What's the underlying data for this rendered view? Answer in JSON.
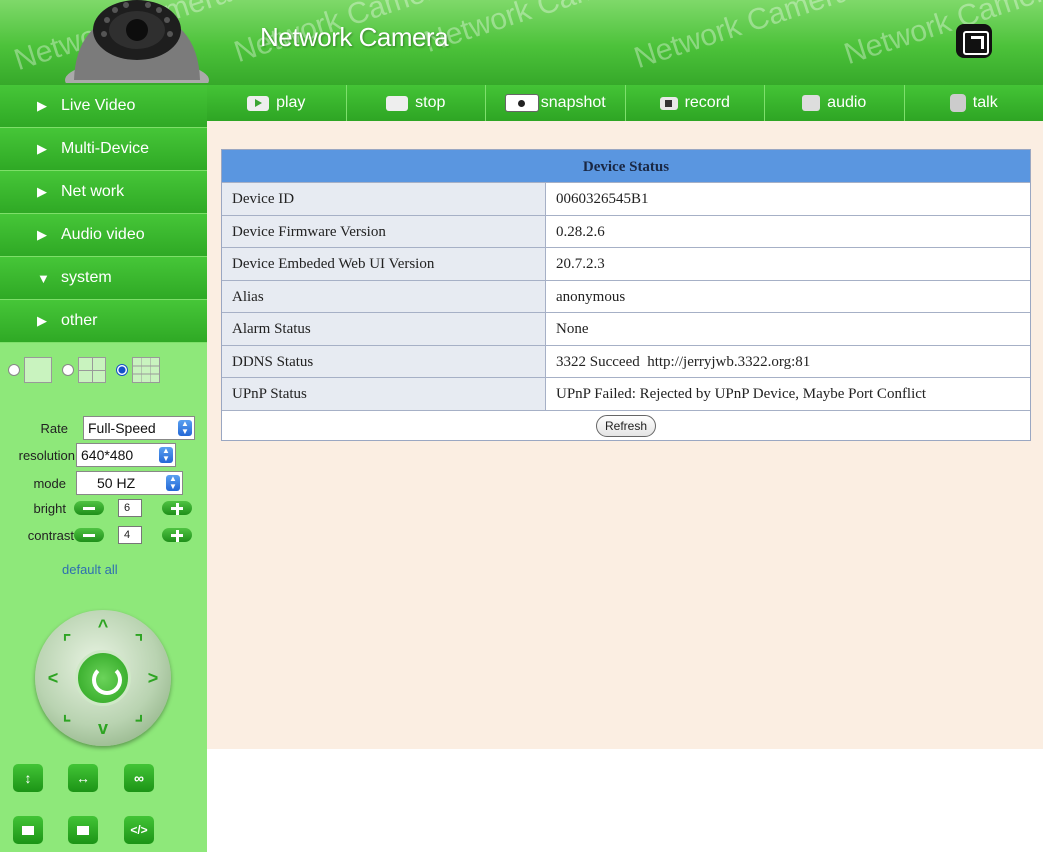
{
  "header": {
    "title": "Network Camera",
    "watermark": "Network Camera",
    "logo_icon": "dome-camera-icon",
    "fullscreen_icon": "fullscreen-icon"
  },
  "sidebar": {
    "menu": [
      {
        "label": "Live Video",
        "expanded": false
      },
      {
        "label": "Multi-Device",
        "expanded": false
      },
      {
        "label": "Net work",
        "expanded": false
      },
      {
        "label": "Audio video",
        "expanded": false
      },
      {
        "label": "system",
        "expanded": true
      },
      {
        "label": "other",
        "expanded": false
      }
    ],
    "controls": {
      "rate_label": "Rate",
      "rate_value": "Full-Speed",
      "resolution_label": "resolution",
      "resolution_value": "640*480",
      "mode_label": "mode",
      "mode_value": "50 HZ",
      "bright_label": "bright",
      "bright_value": "6",
      "contrast_label": "contrast",
      "contrast_value": "4",
      "default_all": "default all"
    }
  },
  "toolbar": {
    "play": "play",
    "stop": "stop",
    "snapshot": "snapshot",
    "record": "record",
    "audio": "audio",
    "talk": "talk"
  },
  "device_status": {
    "caption": "Device Status",
    "rows": [
      {
        "key": "Device ID",
        "value": "0060326545B1"
      },
      {
        "key": "Device Firmware Version",
        "value": "0.28.2.6"
      },
      {
        "key": "Device Embeded Web UI Version",
        "value": "20.7.2.3"
      },
      {
        "key": "Alias",
        "value": "anonymous"
      },
      {
        "key": "Alarm Status",
        "value": "None"
      },
      {
        "key": "DDNS Status",
        "value": "3322 Succeed  http://jerryjwb.3322.org:81"
      },
      {
        "key": "UPnP Status",
        "value": "UPnP Failed: Rejected by UPnP Device, Maybe Port Conflict"
      }
    ],
    "refresh_label": "Refresh"
  },
  "colors": {
    "accent_green": "#2ea524",
    "table_header_blue": "#5a96e0",
    "content_bg": "#fbeee2"
  }
}
